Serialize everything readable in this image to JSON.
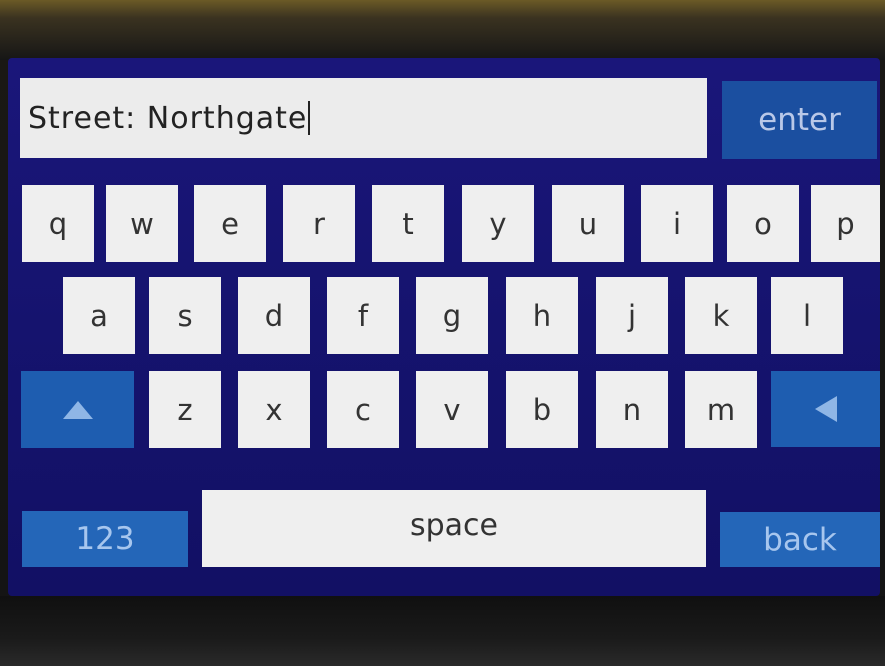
{
  "input": {
    "label": "Street:",
    "value": "Northgate",
    "display": "Street: Northgate"
  },
  "keys": {
    "enter": "enter",
    "row1": [
      "q",
      "w",
      "e",
      "r",
      "t",
      "y",
      "u",
      "i",
      "o",
      "p"
    ],
    "row2": [
      "a",
      "s",
      "d",
      "f",
      "g",
      "h",
      "j",
      "k",
      "l"
    ],
    "row3": [
      "z",
      "x",
      "c",
      "v",
      "b",
      "n",
      "m"
    ],
    "shift_icon": "up-arrow-icon",
    "backspace_icon": "left-arrow-icon",
    "numbers": "123",
    "space": "space",
    "back": "back"
  },
  "colors": {
    "screen_bg": "#15136e",
    "key_bg": "#efefef",
    "function_key_bg": "#1e5db0",
    "enter_bg": "#1b4fa0"
  }
}
